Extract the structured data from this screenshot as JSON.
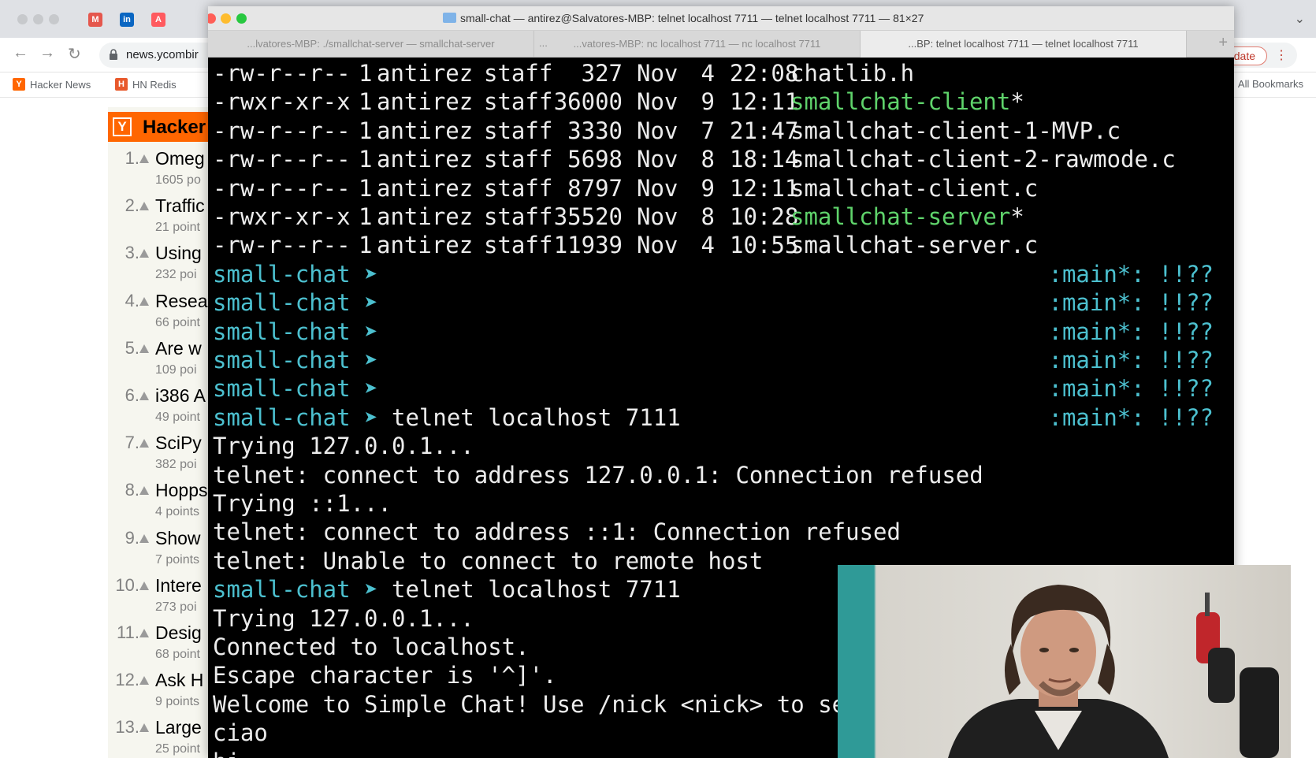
{
  "browser": {
    "bookmarks": [
      {
        "icon": "Y",
        "label": "Hacker News"
      },
      {
        "icon": "H",
        "label": "HN Redis"
      }
    ],
    "url": "news.ycombir",
    "update_label": "o update",
    "all_bookmarks": "All Bookmarks",
    "extension_icons": [
      "gmail-icon",
      "linkedin-icon",
      "airbnb-icon"
    ]
  },
  "hn": {
    "logo": "Y",
    "title": "Hacker",
    "items": [
      {
        "rank": "1.",
        "title": "Omeg",
        "sub": "1605 po"
      },
      {
        "rank": "2.",
        "title": "Traffic",
        "sub": "21 point"
      },
      {
        "rank": "3.",
        "title": "Using",
        "sub": "232 poi"
      },
      {
        "rank": "4.",
        "title": "Resea",
        "sub": "66 point"
      },
      {
        "rank": "5.",
        "title": "Are w",
        "sub": "109 poi"
      },
      {
        "rank": "6.",
        "title": "i386 A",
        "sub": "49 point"
      },
      {
        "rank": "7.",
        "title": "SciPy",
        "sub": "382 poi"
      },
      {
        "rank": "8.",
        "title": "Hopps",
        "sub": "4 points"
      },
      {
        "rank": "9.",
        "title": "Show",
        "sub": "7 points"
      },
      {
        "rank": "10.",
        "title": "Intere",
        "sub": "273 poi"
      },
      {
        "rank": "11.",
        "title": "Desig",
        "sub": "68 point"
      },
      {
        "rank": "12.",
        "title": "Ask H",
        "sub": "9 points"
      },
      {
        "rank": "13.",
        "title": "Large",
        "sub": "25 point"
      }
    ]
  },
  "terminal": {
    "window_title": "small-chat — antirez@Salvatores-MBP: telnet localhost 7711 — telnet localhost 7711 — 81×27",
    "tabs": [
      "...lvatores-MBP: ./smallchat-server — smallchat-server",
      "...vatores-MBP: nc localhost 7711 — nc localhost 7711",
      "...BP: telnet localhost 7711 — telnet localhost 7711"
    ],
    "tab_more": "...",
    "new_tab": "+",
    "listing": [
      {
        "perms": "-rw-r--r--",
        "links": "1",
        "owner": "antirez",
        "group": "staff",
        "size": "327",
        "month": "Nov",
        "day": "4",
        "time": "22:08",
        "name": "chatlib.h",
        "exec": false,
        "mark": ""
      },
      {
        "perms": "-rwxr-xr-x",
        "links": "1",
        "owner": "antirez",
        "group": "staff",
        "size": "36000",
        "month": "Nov",
        "day": "9",
        "time": "12:11",
        "name": "smallchat-client",
        "exec": true,
        "mark": "*"
      },
      {
        "perms": "-rw-r--r--",
        "links": "1",
        "owner": "antirez",
        "group": "staff",
        "size": "3330",
        "month": "Nov",
        "day": "7",
        "time": "21:47",
        "name": "smallchat-client-1-MVP.c",
        "exec": false,
        "mark": ""
      },
      {
        "perms": "-rw-r--r--",
        "links": "1",
        "owner": "antirez",
        "group": "staff",
        "size": "5698",
        "month": "Nov",
        "day": "8",
        "time": "18:14",
        "name": "smallchat-client-2-rawmode.c",
        "exec": false,
        "mark": ""
      },
      {
        "perms": "-rw-r--r--",
        "links": "1",
        "owner": "antirez",
        "group": "staff",
        "size": "8797",
        "month": "Nov",
        "day": "9",
        "time": "12:11",
        "name": "smallchat-client.c",
        "exec": false,
        "mark": ""
      },
      {
        "perms": "-rwxr-xr-x",
        "links": "1",
        "owner": "antirez",
        "group": "staff",
        "size": "35520",
        "month": "Nov",
        "day": "8",
        "time": "10:28",
        "name": "smallchat-server",
        "exec": true,
        "mark": "*"
      },
      {
        "perms": "-rw-r--r--",
        "links": "1",
        "owner": "antirez",
        "group": "staff",
        "size": "11939",
        "month": "Nov",
        "day": "4",
        "time": "10:55",
        "name": "smallchat-server.c",
        "exec": false,
        "mark": ""
      }
    ],
    "prompt": "small-chat",
    "prompt_arrow": "➤",
    "right_prompt": ":main*: !!??",
    "session": [
      {
        "type": "prompt",
        "cmd": "",
        "rprompt": true
      },
      {
        "type": "prompt",
        "cmd": "",
        "rprompt": true
      },
      {
        "type": "prompt",
        "cmd": "",
        "rprompt": true
      },
      {
        "type": "prompt",
        "cmd": "",
        "rprompt": true
      },
      {
        "type": "prompt",
        "cmd": "",
        "rprompt": true
      },
      {
        "type": "prompt",
        "cmd": "telnet localhost 7111",
        "rprompt": true
      },
      {
        "type": "out",
        "text": "Trying 127.0.0.1..."
      },
      {
        "type": "out",
        "text": "telnet: connect to address 127.0.0.1: Connection refused"
      },
      {
        "type": "out",
        "text": "Trying ::1..."
      },
      {
        "type": "out",
        "text": "telnet: connect to address ::1: Connection refused"
      },
      {
        "type": "out",
        "text": "telnet: Unable to connect to remote host"
      },
      {
        "type": "prompt",
        "cmd": "telnet localhost 7711",
        "rprompt": false
      },
      {
        "type": "out",
        "text": "Trying 127.0.0.1..."
      },
      {
        "type": "out",
        "text": "Connected to localhost."
      },
      {
        "type": "out",
        "text": "Escape character is '^]'."
      },
      {
        "type": "out",
        "text": "Welcome to Simple Chat! Use /nick <nick> to set yo"
      },
      {
        "type": "out",
        "text": "ciao"
      },
      {
        "type": "out",
        "text": "hi"
      }
    ]
  },
  "colors": {
    "prompt": "#4cc0cf",
    "executable": "#5fd36b",
    "terminal_bg": "#000000",
    "hn_orange": "#ff6600"
  }
}
